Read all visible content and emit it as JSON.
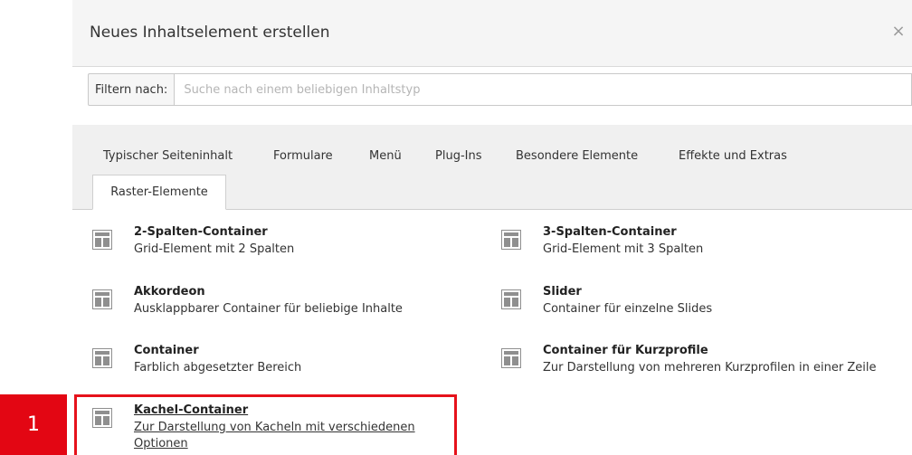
{
  "dialog": {
    "title": "Neues Inhaltselement erstellen",
    "close": "×"
  },
  "filter": {
    "label": "Filtern nach:",
    "placeholder": "Suche nach einem beliebigen Inhaltstyp",
    "value": ""
  },
  "tabs": [
    {
      "label": "Typischer Seiteninhalt"
    },
    {
      "label": "Formulare"
    },
    {
      "label": "Menü"
    },
    {
      "label": "Plug-Ins"
    },
    {
      "label": "Besondere Elemente"
    },
    {
      "label": "Effekte und Extras"
    },
    {
      "label": "Raster-Elemente",
      "active": true
    }
  ],
  "items": [
    {
      "title": "2-Spalten-Container",
      "desc": "Grid-Element mit 2 Spalten",
      "icon": "grid-layout-icon"
    },
    {
      "title": "3-Spalten-Container",
      "desc": "Grid-Element mit 3 Spalten",
      "icon": "grid-layout-icon"
    },
    {
      "title": "Akkordeon",
      "desc": "Ausklappbarer Container für beliebige Inhalte",
      "icon": "grid-layout-icon"
    },
    {
      "title": "Slider",
      "desc": "Container für einzelne Slides",
      "icon": "grid-layout-icon"
    },
    {
      "title": "Container",
      "desc": "Farblich abgesetzter Bereich",
      "icon": "grid-layout-icon"
    },
    {
      "title": "Container für Kurzprofile",
      "desc": "Zur Darstellung von mehreren Kurzprofilen in einer Zeile",
      "icon": "grid-layout-icon"
    },
    {
      "title": "Kachel-Container",
      "desc": "Zur Darstellung von Kacheln mit verschiedenen Optionen",
      "icon": "grid-layout-icon"
    }
  ],
  "annotation": {
    "label": "1",
    "color": "#e30613"
  }
}
